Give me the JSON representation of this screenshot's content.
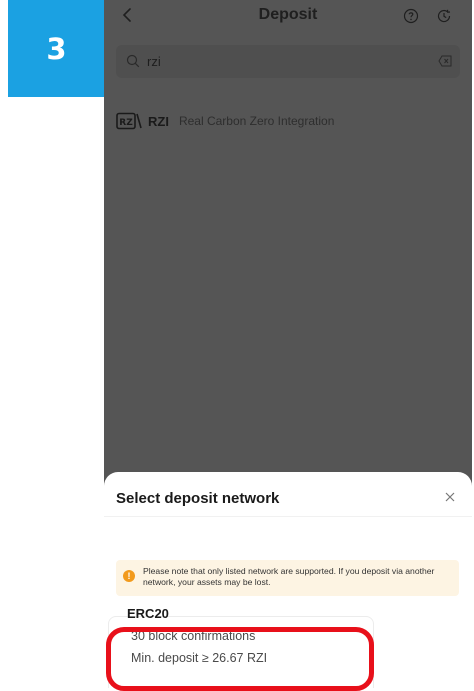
{
  "step_badge": "3",
  "header": {
    "title": "Deposit",
    "back_icon": "chevron-left-icon",
    "help_icon": "question-circle-icon",
    "history_icon": "history-clock-icon"
  },
  "search": {
    "value": "rzi",
    "icon": "search-icon",
    "clear_icon": "clear-icon"
  },
  "results": [
    {
      "logo": "RZ",
      "symbol": "RZI",
      "name": "Real Carbon Zero Integration"
    }
  ],
  "sheet": {
    "title": "Select deposit network",
    "close_icon": "close-icon",
    "notice": "Please note that only listed network are supported. If you deposit via another network, your assets may be lost.",
    "networks": [
      {
        "name": "ERC20",
        "confirmations": "30 block confirmations",
        "min_deposit": "Min. deposit ≥ 26.67 RZI"
      }
    ]
  },
  "colors": {
    "badge": "#1ba1e2",
    "overlay": "#555555",
    "notice_bg": "#fdf4e3",
    "warning": "#f29a1c",
    "highlight": "#e8101a"
  }
}
